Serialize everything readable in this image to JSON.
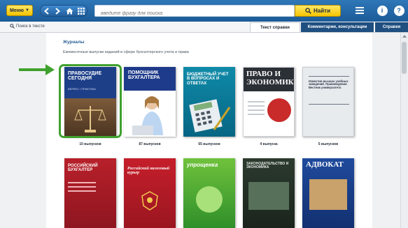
{
  "toolbar": {
    "menu_label": "Меню",
    "search_placeholder": "введите фразу для поиска",
    "find_label": "Найти",
    "icons": [
      "back-icon",
      "forward-icon",
      "home-icon",
      "grid-icon",
      "search-icon",
      "menu-icon",
      "info-icon",
      "help-icon"
    ]
  },
  "subbar": {
    "search_in_text": "Поиск в тексте",
    "tabs": [
      "Текст справки",
      "Комментарии, консультации",
      "Справки"
    ]
  },
  "content": {
    "heading": "Журналы",
    "subtitle": "Ежемесячные выпуски изданий в сфере бухгалтерского учета и права"
  },
  "journals_row1": [
    {
      "cover_title": "ПРАВОСУДИЕ СЕГОДНЯ",
      "cover_subtitle": "ВЕРЛЕС / ПРАКТИКА",
      "count": "10 выпусков"
    },
    {
      "cover_title": "ПОМОЩНИК БУХГАЛТЕРА",
      "cover_subtitle": "",
      "count": "87 выпусков"
    },
    {
      "cover_title": "БЮДЖЕТНЫЙ УЧЕТ В ВОПРОСАХ И ОТВЕТАХ",
      "cover_subtitle": "",
      "count": "65 выпусков"
    },
    {
      "cover_title": "ПРАВО И ЭКОНОМИКА",
      "cover_subtitle": "",
      "count": "4 выпуска"
    },
    {
      "cover_title": "Известия высших учебных заведений. Правоведение. Вестник университета",
      "cover_subtitle": "",
      "count": "5 выпусков"
    }
  ],
  "journals_row2": [
    {
      "cover_title": "РОССИЙСКИЙ БУХГАЛТЕР"
    },
    {
      "cover_title": "Российский налоговый курьер"
    },
    {
      "cover_title": "упрощенка"
    },
    {
      "cover_title": "ЗАКОНОДАТЕЛЬСТВО И ЭКОНОМИКА"
    },
    {
      "cover_title": "АДВОКАТ"
    }
  ],
  "colors": {
    "toolbar_blue": "#1f65a6",
    "accent_yellow": "#f5c400",
    "highlight_green": "#3fa12e",
    "heading_blue": "#2a5f95"
  }
}
